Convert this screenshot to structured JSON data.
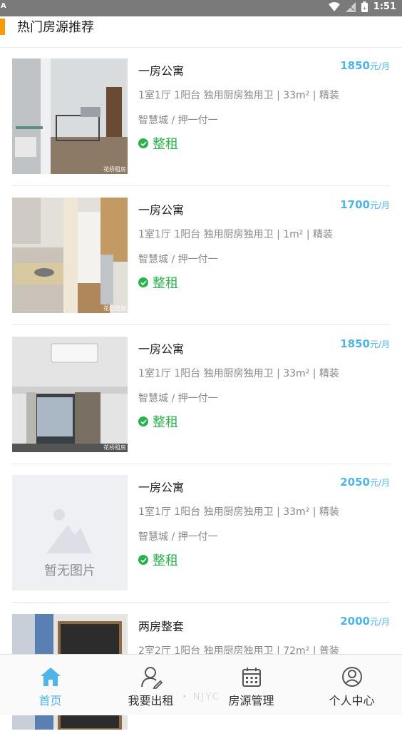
{
  "status_bar": {
    "left_icon": "A",
    "time": "1:51"
  },
  "section": {
    "title": "热门房源推荐"
  },
  "listings": [
    {
      "title": "一房公寓",
      "price": "1850",
      "unit": "元/月",
      "spec": "1室1厅 1阳台 独用厨房独用卫 | 33m² | 精装",
      "area": "智慧城 / 押一付一",
      "tag": "整租",
      "watermark": "花桥租房"
    },
    {
      "title": "一房公寓",
      "price": "1700",
      "unit": "元/月",
      "spec": "1室1厅 1阳台 独用厨房独用卫 | 1m² | 精装",
      "area": "智慧城 / 押一付一",
      "tag": "整租",
      "watermark": "花桥租房"
    },
    {
      "title": "一房公寓",
      "price": "1850",
      "unit": "元/月",
      "spec": "1室1厅 1阳台 独用厨房独用卫 | 33m² | 精装",
      "area": "智慧城 / 押一付一",
      "tag": "整租",
      "watermark": "花桥租房"
    },
    {
      "title": "一房公寓",
      "price": "2050",
      "unit": "元/月",
      "spec": "1室1厅 1阳台 独用厨房独用卫 | 33m² | 精装",
      "area": "智慧城 / 押一付一",
      "tag": "整租",
      "placeholder": "暂无图片"
    },
    {
      "title": "两房整套",
      "price": "2000",
      "unit": "元/月",
      "spec": "2室2厅 1阳台 独用厨房独用卫 | 72m² | 普装"
    }
  ],
  "tabbar": {
    "tabs": [
      {
        "label": "首页",
        "icon": "home-icon",
        "active": true
      },
      {
        "label": "我要出租",
        "icon": "user-edit-icon"
      },
      {
        "label": "房源管理",
        "icon": "calendar-icon"
      },
      {
        "label": "个人中心",
        "icon": "user-circle-icon"
      }
    ],
    "overlay": "• NJYC"
  },
  "colors": {
    "accent": "#ff9900",
    "price": "#4fb4e8",
    "tag": "#2bb24c",
    "active_tab": "#4fb4e8"
  }
}
